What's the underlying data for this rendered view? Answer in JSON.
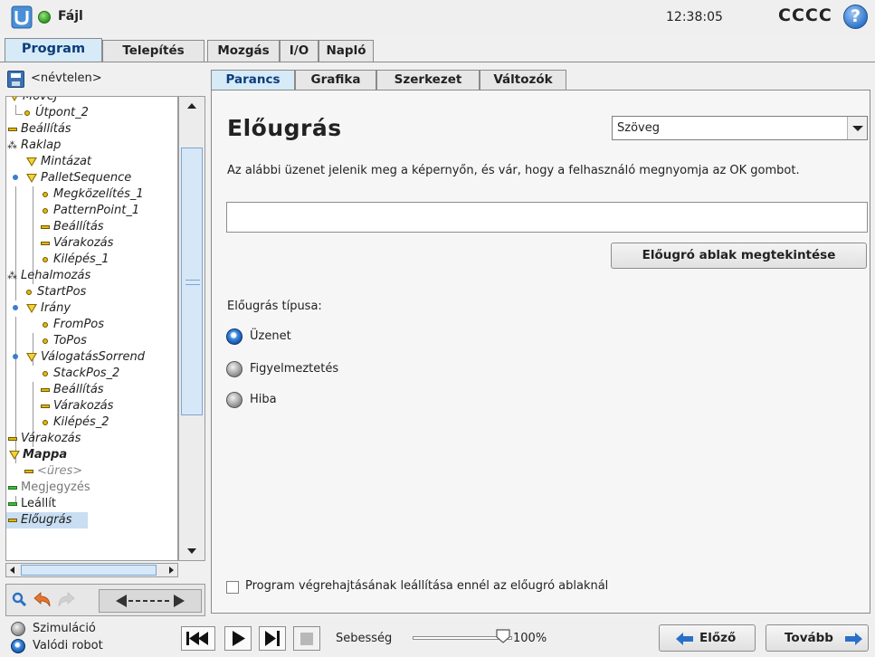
{
  "titlebar": {
    "file_label": "Fájl",
    "clock": "12:38:05",
    "robot_name": "CCCC",
    "help_label": "?"
  },
  "main_tabs": [
    "Program",
    "Telepítés",
    "Mozgás",
    "I/O",
    "Napló"
  ],
  "active_main_tab": "Program",
  "file": {
    "name": "<névtelen>"
  },
  "tree": [
    {
      "label": "MoveJ",
      "icon": "triangle"
    },
    {
      "label": "Útpont_2",
      "icon": "dot"
    },
    {
      "label": "Beállítás",
      "icon": "bar"
    },
    {
      "label": "Raklap",
      "icon": "pallet"
    },
    {
      "label": "Mintázat",
      "icon": "triangle"
    },
    {
      "label": "PalletSequence",
      "icon": "triangle"
    },
    {
      "label": "Megközelítés_1",
      "icon": "dot"
    },
    {
      "label": "PatternPoint_1",
      "icon": "dot"
    },
    {
      "label": "Beállítás",
      "icon": "bar"
    },
    {
      "label": "Várakozás",
      "icon": "bar"
    },
    {
      "label": "Kilépés_1",
      "icon": "dot"
    },
    {
      "label": "Lehalmozás",
      "icon": "pallet"
    },
    {
      "label": "StartPos",
      "icon": "dot"
    },
    {
      "label": "Irány",
      "icon": "triangle"
    },
    {
      "label": "FromPos",
      "icon": "dot"
    },
    {
      "label": "ToPos",
      "icon": "dot"
    },
    {
      "label": "VálogatásSorrend",
      "icon": "triangle"
    },
    {
      "label": "StackPos_2",
      "icon": "dot"
    },
    {
      "label": "Beállítás",
      "icon": "bar"
    },
    {
      "label": "Várakozás",
      "icon": "bar"
    },
    {
      "label": "Kilépés_2",
      "icon": "dot"
    },
    {
      "label": "Várakozás",
      "icon": "bar"
    },
    {
      "label": "Mappa",
      "icon": "triangle"
    },
    {
      "label": "<üres>",
      "icon": "bar"
    },
    {
      "label": "Megjegyzés",
      "icon": "bar-green"
    },
    {
      "label": "Leállít",
      "icon": "bar-green"
    },
    {
      "label": "Előugrás",
      "icon": "bar"
    }
  ],
  "content_tabs": [
    "Parancs",
    "Grafika",
    "Szerkezet",
    "Változók"
  ],
  "active_content_tab": "Parancs",
  "popup": {
    "title": "Előugrás",
    "type_select_value": "Szöveg",
    "description": "Az alábbi üzenet jelenik meg a képernyőn, és vár, hogy a felhasználó megnyomja az OK gombot.",
    "message_value": "",
    "preview_button": "Előugró ablak megtekintése",
    "type_label": "Előugrás típusa:",
    "types": [
      "Üzenet",
      "Figyelmeztetés",
      "Hiba"
    ],
    "selected_type": "Üzenet",
    "stop_checkbox_label": "Program végrehajtásának leállítása ennél az előugró ablaknál",
    "stop_checked": false
  },
  "footer": {
    "modes": [
      "Szimuláció",
      "Valódi robot"
    ],
    "active_mode": "Valódi robot",
    "speed_label": "Sebesség",
    "speed_value": "100%",
    "speed_fraction": 1.0,
    "prev_button": "Előző",
    "next_button": "Tovább"
  },
  "colors": {
    "tab_active_bg": "#d6eaf8",
    "tab_active_text": "#0c3d7a",
    "selected_node_bg": "#c9def2",
    "radio_on": "#2a70c8"
  }
}
